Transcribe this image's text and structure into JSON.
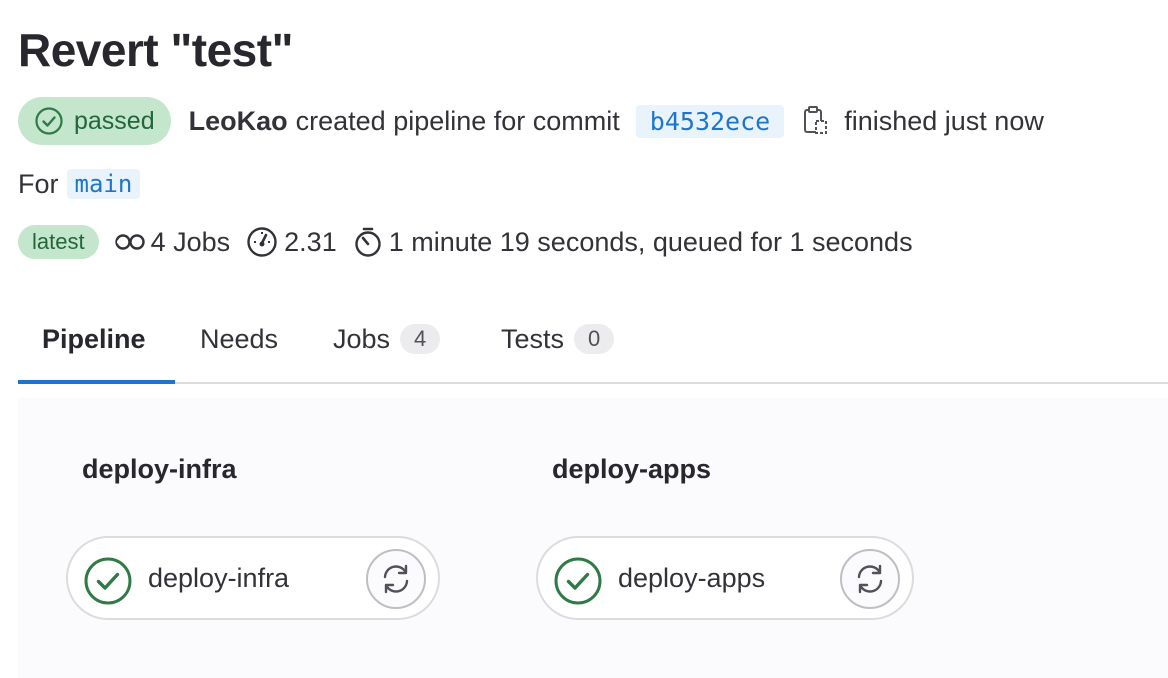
{
  "page": {
    "title": "Revert \"test\""
  },
  "header": {
    "status": "passed",
    "author": "LeoKao",
    "action_text": "created pipeline for commit",
    "commit_sha": "b4532ece",
    "finished_text": "finished just now",
    "for_label": "For",
    "branch": "main"
  },
  "meta": {
    "latest_badge": "latest",
    "jobs": "4 Jobs",
    "compute": "2.31",
    "duration": "1 minute 19 seconds, queued for 1 seconds"
  },
  "tabs": [
    {
      "label": "Pipeline",
      "active": true
    },
    {
      "label": "Needs"
    },
    {
      "label": "Jobs",
      "count": "4"
    },
    {
      "label": "Tests",
      "count": "0"
    }
  ],
  "stages": [
    {
      "title": "deploy-infra",
      "job": {
        "name": "deploy-infra",
        "status": "success"
      }
    },
    {
      "title": "deploy-apps",
      "job": {
        "name": "deploy-apps",
        "status": "success"
      }
    }
  ],
  "colors": {
    "success": "#2f7a47",
    "success_bg": "#c3e6cd",
    "link": "#1f75cb",
    "tab_active": "#1f75cb"
  },
  "icons": {
    "status": "check-circle-icon",
    "copy": "copy-to-clipboard-icon",
    "jobs": "pipeline-jobs-icon",
    "compute": "gauge-icon",
    "duration": "stopwatch-icon",
    "retry": "retry-icon"
  }
}
